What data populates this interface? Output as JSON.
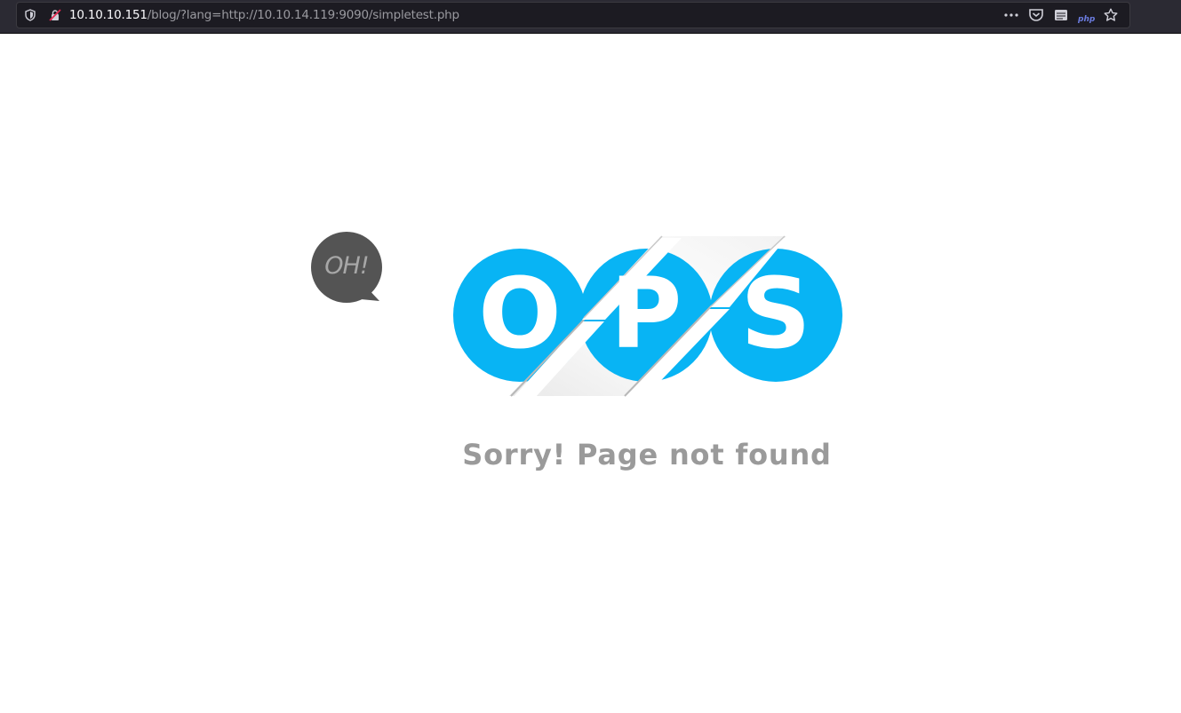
{
  "browser": {
    "url_host": "10.10.10.151",
    "url_path": "/blog/?lang=http://10.10.14.119:9090/simpletest.php",
    "icons": [
      "shield-icon",
      "insecure-lock-icon",
      "more-actions-icon",
      "pocket-icon",
      "reader-icon",
      "php-extension-icon",
      "bookmark-star-icon"
    ],
    "php_badge": "php"
  },
  "page": {
    "bubble_text": "OH!",
    "letters": [
      "O",
      "P",
      "S"
    ],
    "message": "Sorry! Page not found",
    "colors": {
      "circle": "#08b4f4",
      "bubble": "#545454",
      "message": "#9a9a9a"
    }
  }
}
